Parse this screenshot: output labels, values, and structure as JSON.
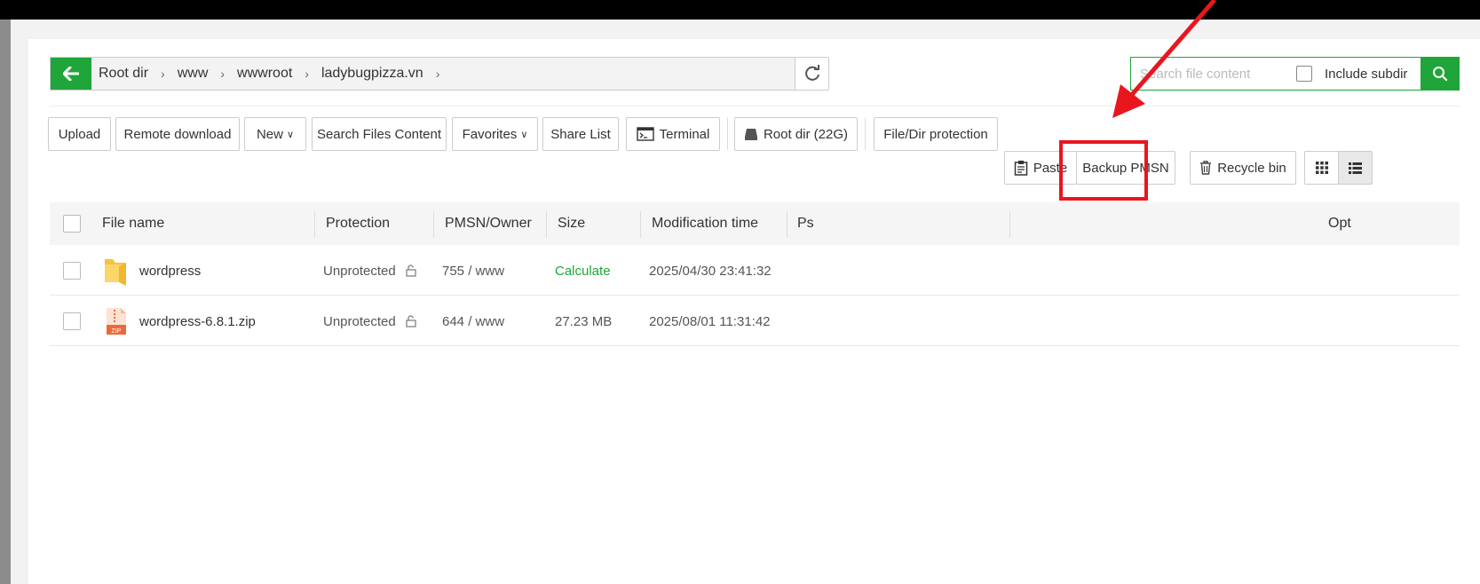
{
  "breadcrumb": {
    "items": [
      "Root dir",
      "www",
      "wwwroot",
      "ladybugpizza.vn"
    ]
  },
  "search": {
    "placeholder": "Search file content",
    "include_subdir": "Include subdir"
  },
  "toolbar": {
    "upload": "Upload",
    "remote_download": "Remote download",
    "new": "New",
    "search_files_content": "Search Files Content",
    "favorites": "Favorites",
    "share_list": "Share List",
    "terminal": "Terminal",
    "root_dir": "Root dir (22G)",
    "file_dir_protection": "File/Dir protection",
    "paste": "Paste",
    "backup_pmsn": "Backup PMSN",
    "recycle_bin": "Recycle bin"
  },
  "table": {
    "headers": {
      "file_name": "File name",
      "protection": "Protection",
      "pmsn_owner": "PMSN/Owner",
      "size": "Size",
      "modification_time": "Modification time",
      "ps": "Ps",
      "opt": "Opt"
    },
    "rows": [
      {
        "name": "wordpress",
        "protection": "Unprotected",
        "pmsn": "755 / www",
        "size": "Calculate",
        "mtime": "2025/04/30 23:41:32"
      },
      {
        "name": "wordpress-6.8.1.zip",
        "protection": "Unprotected",
        "pmsn": "644 / www",
        "size": "27.23 MB",
        "mtime": "2025/08/01 11:31:42"
      }
    ]
  },
  "colors": {
    "accent": "#20a53a",
    "highlight": "#e8161f"
  },
  "icons": [
    "back-arrow-icon",
    "chevron-right-icon",
    "refresh-icon",
    "search-icon",
    "chevron-down-icon",
    "terminal-icon",
    "disk-icon",
    "clipboard-icon",
    "trash-icon",
    "grid-view-icon",
    "list-view-icon",
    "folder-icon",
    "zip-file-icon",
    "unlock-icon"
  ]
}
